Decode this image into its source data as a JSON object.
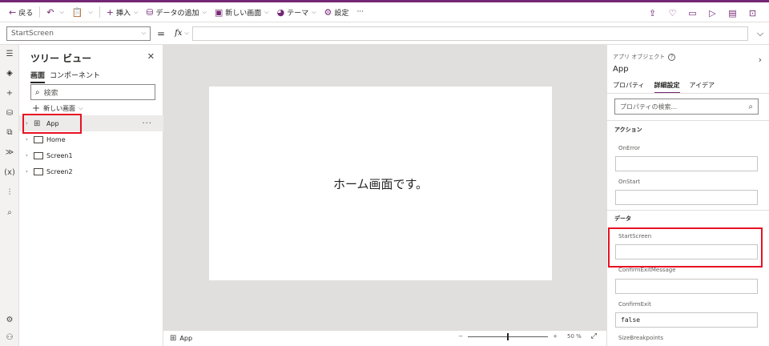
{
  "toolbar": {
    "back": "戻る",
    "insert": "挿入",
    "add_data": "データの追加",
    "new_screen": "新しい画面",
    "theme": "テーマ",
    "settings": "設定",
    "more": "···"
  },
  "formula_bar": {
    "property": "StartScreen",
    "equals": "=",
    "fx": "fx",
    "formula": ""
  },
  "tree": {
    "title": "ツリー ビュー",
    "tabs": [
      "画面",
      "コンポーネント"
    ],
    "search_placeholder": "検索",
    "new_screen": "新しい画面",
    "items": [
      {
        "label": "App",
        "selected": true
      },
      {
        "label": "Home"
      },
      {
        "label": "Screen1"
      },
      {
        "label": "Screen2"
      }
    ],
    "more": "···"
  },
  "canvas": {
    "label": "ホーム画面です。"
  },
  "statusbar": {
    "screen": "App",
    "zoom_value": "50",
    "zoom_unit": "%"
  },
  "properties": {
    "header": "アプリ オブジェクト",
    "object": "App",
    "tabs": [
      "プロパティ",
      "詳細設定",
      "アイデア"
    ],
    "search_placeholder": "プロパティの検索...",
    "sections": {
      "action": "アクション",
      "data": "データ"
    },
    "fields": {
      "on_error": {
        "label": "OnError",
        "value": ""
      },
      "on_start": {
        "label": "OnStart",
        "value": ""
      },
      "start_screen": {
        "label": "StartScreen",
        "value": ""
      },
      "confirm_exit_message": {
        "label": "ConfirmExitMessage",
        "value": ""
      },
      "confirm_exit": {
        "label": "ConfirmExit",
        "value": "false"
      },
      "size_breakpoints": {
        "label": "SizeBreakpoints"
      }
    }
  },
  "colors": {
    "accent": "#742774",
    "highlight": "#e81123"
  }
}
